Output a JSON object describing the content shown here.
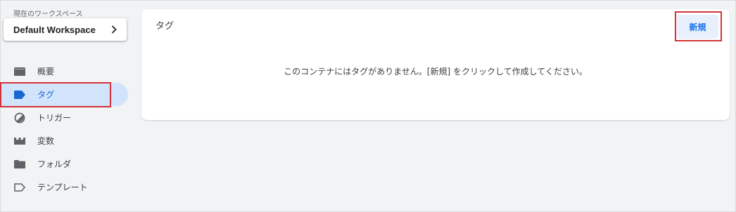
{
  "workspace": {
    "label": "現在のワークスペース",
    "name": "Default Workspace"
  },
  "nav": {
    "items": [
      {
        "label": "概要",
        "icon": "overview-icon"
      },
      {
        "label": "タグ",
        "icon": "tag-icon",
        "active": true
      },
      {
        "label": "トリガー",
        "icon": "trigger-icon"
      },
      {
        "label": "変数",
        "icon": "variables-icon"
      },
      {
        "label": "フォルダ",
        "icon": "folder-icon"
      },
      {
        "label": "テンプレート",
        "icon": "template-icon"
      }
    ]
  },
  "main": {
    "title": "タグ",
    "new_button": "新規",
    "empty_message": "このコンテナにはタグがありません。[新規] をクリックして作成してください。"
  },
  "colors": {
    "accent": "#1a73e8",
    "active_bg": "#d2e3fc",
    "highlight": "#d13438",
    "background": "#f1f3f4"
  }
}
